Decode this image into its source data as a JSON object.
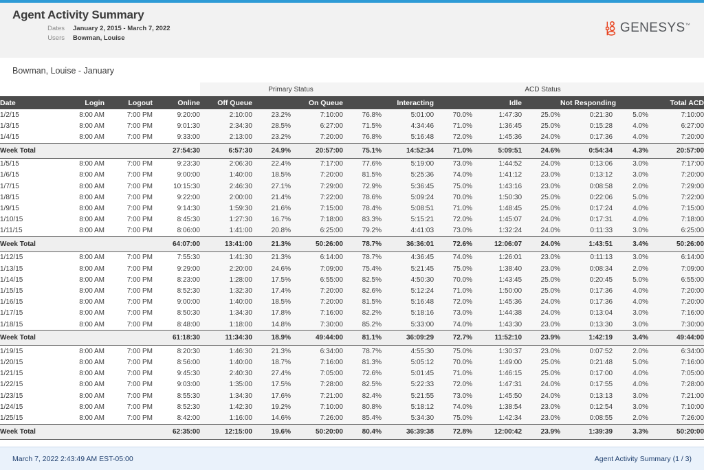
{
  "accent_color": "#2e9bd6",
  "header": {
    "title": "Agent Activity Summary",
    "meta": [
      {
        "label": "Dates",
        "value": "January 2, 2015 - March 7, 2022"
      },
      {
        "label": "Users",
        "value": "Bowman, Louise"
      }
    ],
    "logo": {
      "word": "GENESYS",
      "tm": "™",
      "mark_color": "#e8431f"
    }
  },
  "section_caption": "Bowman, Louise - January",
  "table": {
    "group_headers": [
      {
        "label": "",
        "span": 4,
        "shaded": false
      },
      {
        "label": "Primary Status",
        "span": 4,
        "shaded": true
      },
      {
        "label": "ACD Status",
        "span": 8,
        "shaded": true
      }
    ],
    "columns": [
      {
        "key": "date",
        "label": "Date",
        "align": "l"
      },
      {
        "key": "login",
        "label": "Login",
        "align": "r"
      },
      {
        "key": "logout",
        "label": "Logout",
        "align": "r"
      },
      {
        "key": "online",
        "label": "Online",
        "align": "r"
      },
      {
        "key": "offq",
        "label": "Off Queue",
        "align": "r"
      },
      {
        "key": "offq_pct",
        "label": "",
        "align": "r"
      },
      {
        "key": "onq",
        "label": "On Queue",
        "align": "r"
      },
      {
        "key": "onq_pct",
        "label": "",
        "align": "r"
      },
      {
        "key": "interacting",
        "label": "Interacting",
        "align": "r"
      },
      {
        "key": "int_pct",
        "label": "",
        "align": "r"
      },
      {
        "key": "idle",
        "label": "Idle",
        "align": "r"
      },
      {
        "key": "idle_pct",
        "label": "",
        "align": "r"
      },
      {
        "key": "notresp",
        "label": "Not Responding",
        "align": "r"
      },
      {
        "key": "notresp_pct",
        "label": "",
        "align": "r"
      },
      {
        "key": "totalacd",
        "label": "Total ACD",
        "align": "r"
      }
    ],
    "total_label": "Week Total",
    "weeks": [
      {
        "rows": [
          [
            "1/2/15",
            "8:00 AM",
            "7:00 PM",
            "9:20:00",
            "2:10:00",
            "23.2%",
            "7:10:00",
            "76.8%",
            "5:01:00",
            "70.0%",
            "1:47:30",
            "25.0%",
            "0:21:30",
            "5.0%",
            "7:10:00"
          ],
          [
            "1/3/15",
            "8:00 AM",
            "7:00 PM",
            "9:01:30",
            "2:34:30",
            "28.5%",
            "6:27:00",
            "71.5%",
            "4:34:46",
            "71.0%",
            "1:36:45",
            "25.0%",
            "0:15:28",
            "4.0%",
            "6:27:00"
          ],
          [
            "1/4/15",
            "8:00 AM",
            "7:00 PM",
            "9:33:00",
            "2:13:00",
            "23.2%",
            "7:20:00",
            "76.8%",
            "5:16:48",
            "72.0%",
            "1:45:36",
            "24.0%",
            "0:17:36",
            "4.0%",
            "7:20:00"
          ]
        ],
        "total": [
          "Week Total",
          "",
          "",
          "27:54:30",
          "6:57:30",
          "24.9%",
          "20:57:00",
          "75.1%",
          "14:52:34",
          "71.0%",
          "5:09:51",
          "24.6%",
          "0:54:34",
          "4.3%",
          "20:57:00"
        ]
      },
      {
        "rows": [
          [
            "1/5/15",
            "8:00 AM",
            "7:00 PM",
            "9:23:30",
            "2:06:30",
            "22.4%",
            "7:17:00",
            "77.6%",
            "5:19:00",
            "73.0%",
            "1:44:52",
            "24.0%",
            "0:13:06",
            "3.0%",
            "7:17:00"
          ],
          [
            "1/6/15",
            "8:00 AM",
            "7:00 PM",
            "9:00:00",
            "1:40:00",
            "18.5%",
            "7:20:00",
            "81.5%",
            "5:25:36",
            "74.0%",
            "1:41:12",
            "23.0%",
            "0:13:12",
            "3.0%",
            "7:20:00"
          ],
          [
            "1/7/15",
            "8:00 AM",
            "7:00 PM",
            "10:15:30",
            "2:46:30",
            "27.1%",
            "7:29:00",
            "72.9%",
            "5:36:45",
            "75.0%",
            "1:43:16",
            "23.0%",
            "0:08:58",
            "2.0%",
            "7:29:00"
          ],
          [
            "1/8/15",
            "8:00 AM",
            "7:00 PM",
            "9:22:00",
            "2:00:00",
            "21.4%",
            "7:22:00",
            "78.6%",
            "5:09:24",
            "70.0%",
            "1:50:30",
            "25.0%",
            "0:22:06",
            "5.0%",
            "7:22:00"
          ],
          [
            "1/9/15",
            "8:00 AM",
            "7:00 PM",
            "9:14:30",
            "1:59:30",
            "21.6%",
            "7:15:00",
            "78.4%",
            "5:08:51",
            "71.0%",
            "1:48:45",
            "25.0%",
            "0:17:24",
            "4.0%",
            "7:15:00"
          ],
          [
            "1/10/15",
            "8:00 AM",
            "7:00 PM",
            "8:45:30",
            "1:27:30",
            "16.7%",
            "7:18:00",
            "83.3%",
            "5:15:21",
            "72.0%",
            "1:45:07",
            "24.0%",
            "0:17:31",
            "4.0%",
            "7:18:00"
          ],
          [
            "1/11/15",
            "8:00 AM",
            "7:00 PM",
            "8:06:00",
            "1:41:00",
            "20.8%",
            "6:25:00",
            "79.2%",
            "4:41:03",
            "73.0%",
            "1:32:24",
            "24.0%",
            "0:11:33",
            "3.0%",
            "6:25:00"
          ]
        ],
        "total": [
          "Week Total",
          "",
          "",
          "64:07:00",
          "13:41:00",
          "21.3%",
          "50:26:00",
          "78.7%",
          "36:36:01",
          "72.6%",
          "12:06:07",
          "24.0%",
          "1:43:51",
          "3.4%",
          "50:26:00"
        ]
      },
      {
        "rows": [
          [
            "1/12/15",
            "8:00 AM",
            "7:00 PM",
            "7:55:30",
            "1:41:30",
            "21.3%",
            "6:14:00",
            "78.7%",
            "4:36:45",
            "74.0%",
            "1:26:01",
            "23.0%",
            "0:11:13",
            "3.0%",
            "6:14:00"
          ],
          [
            "1/13/15",
            "8:00 AM",
            "7:00 PM",
            "9:29:00",
            "2:20:00",
            "24.6%",
            "7:09:00",
            "75.4%",
            "5:21:45",
            "75.0%",
            "1:38:40",
            "23.0%",
            "0:08:34",
            "2.0%",
            "7:09:00"
          ],
          [
            "1/14/15",
            "8:00 AM",
            "7:00 PM",
            "8:23:00",
            "1:28:00",
            "17.5%",
            "6:55:00",
            "82.5%",
            "4:50:30",
            "70.0%",
            "1:43:45",
            "25.0%",
            "0:20:45",
            "5.0%",
            "6:55:00"
          ],
          [
            "1/15/15",
            "8:00 AM",
            "7:00 PM",
            "8:52:30",
            "1:32:30",
            "17.4%",
            "7:20:00",
            "82.6%",
            "5:12:24",
            "71.0%",
            "1:50:00",
            "25.0%",
            "0:17:36",
            "4.0%",
            "7:20:00"
          ],
          [
            "1/16/15",
            "8:00 AM",
            "7:00 PM",
            "9:00:00",
            "1:40:00",
            "18.5%",
            "7:20:00",
            "81.5%",
            "5:16:48",
            "72.0%",
            "1:45:36",
            "24.0%",
            "0:17:36",
            "4.0%",
            "7:20:00"
          ],
          [
            "1/17/15",
            "8:00 AM",
            "7:00 PM",
            "8:50:30",
            "1:34:30",
            "17.8%",
            "7:16:00",
            "82.2%",
            "5:18:16",
            "73.0%",
            "1:44:38",
            "24.0%",
            "0:13:04",
            "3.0%",
            "7:16:00"
          ],
          [
            "1/18/15",
            "8:00 AM",
            "7:00 PM",
            "8:48:00",
            "1:18:00",
            "14.8%",
            "7:30:00",
            "85.2%",
            "5:33:00",
            "74.0%",
            "1:43:30",
            "23.0%",
            "0:13:30",
            "3.0%",
            "7:30:00"
          ]
        ],
        "total": [
          "Week Total",
          "",
          "",
          "61:18:30",
          "11:34:30",
          "18.9%",
          "49:44:00",
          "81.1%",
          "36:09:29",
          "72.7%",
          "11:52:10",
          "23.9%",
          "1:42:19",
          "3.4%",
          "49:44:00"
        ]
      },
      {
        "rows": [
          [
            "1/19/15",
            "8:00 AM",
            "7:00 PM",
            "8:20:30",
            "1:46:30",
            "21.3%",
            "6:34:00",
            "78.7%",
            "4:55:30",
            "75.0%",
            "1:30:37",
            "23.0%",
            "0:07:52",
            "2.0%",
            "6:34:00"
          ],
          [
            "1/20/15",
            "8:00 AM",
            "7:00 PM",
            "8:56:00",
            "1:40:00",
            "18.7%",
            "7:16:00",
            "81.3%",
            "5:05:12",
            "70.0%",
            "1:49:00",
            "25.0%",
            "0:21:48",
            "5.0%",
            "7:16:00"
          ],
          [
            "1/21/15",
            "8:00 AM",
            "7:00 PM",
            "9:45:30",
            "2:40:30",
            "27.4%",
            "7:05:00",
            "72.6%",
            "5:01:45",
            "71.0%",
            "1:46:15",
            "25.0%",
            "0:17:00",
            "4.0%",
            "7:05:00"
          ],
          [
            "1/22/15",
            "8:00 AM",
            "7:00 PM",
            "9:03:00",
            "1:35:00",
            "17.5%",
            "7:28:00",
            "82.5%",
            "5:22:33",
            "72.0%",
            "1:47:31",
            "24.0%",
            "0:17:55",
            "4.0%",
            "7:28:00"
          ],
          [
            "1/23/15",
            "8:00 AM",
            "7:00 PM",
            "8:55:30",
            "1:34:30",
            "17.6%",
            "7:21:00",
            "82.4%",
            "5:21:55",
            "73.0%",
            "1:45:50",
            "24.0%",
            "0:13:13",
            "3.0%",
            "7:21:00"
          ],
          [
            "1/24/15",
            "8:00 AM",
            "7:00 PM",
            "8:52:30",
            "1:42:30",
            "19.2%",
            "7:10:00",
            "80.8%",
            "5:18:12",
            "74.0%",
            "1:38:54",
            "23.0%",
            "0:12:54",
            "3.0%",
            "7:10:00"
          ],
          [
            "1/25/15",
            "8:00 AM",
            "7:00 PM",
            "8:42:00",
            "1:16:00",
            "14.6%",
            "7:26:00",
            "85.4%",
            "5:34:30",
            "75.0%",
            "1:42:34",
            "23.0%",
            "0:08:55",
            "2.0%",
            "7:26:00"
          ]
        ],
        "total": [
          "Week Total",
          "",
          "",
          "62:35:00",
          "12:15:00",
          "19.6%",
          "50:20:00",
          "80.4%",
          "36:39:38",
          "72.8%",
          "12:00:42",
          "23.9%",
          "1:39:39",
          "3.3%",
          "50:20:00"
        ]
      }
    ]
  },
  "footer": {
    "left": "March 7, 2022 2:43:49 AM EST-05:00",
    "right": "Agent Activity Summary (1 / 3)"
  }
}
